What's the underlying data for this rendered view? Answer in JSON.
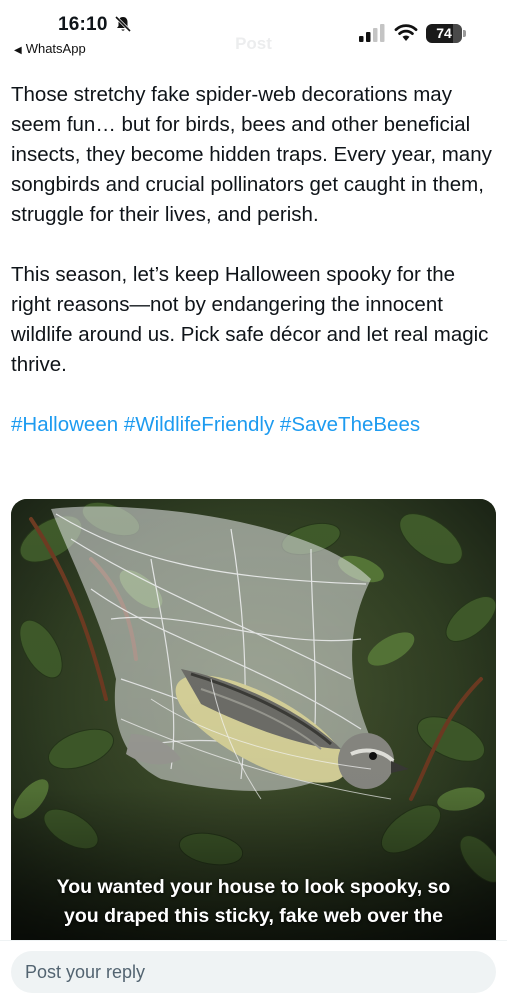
{
  "status_bar": {
    "time": "16:10",
    "back_app": "WhatsApp",
    "battery": "74",
    "header_title": "Post"
  },
  "post": {
    "paragraphs": [
      "Those stretchy fake spider-web decorations may seem fun… but for birds, bees and other beneficial insects, they become hidden traps. Every year, many songbirds and crucial pollinators get caught in them, struggle for their lives, and perish.",
      "This season, let’s keep Halloween spooky for the right reasons—not by endangering the innocent wildlife around us. Pick safe décor and let real magic thrive."
    ],
    "hashtags": [
      "#Halloween",
      "#WildlifeFriendly",
      "#SaveTheBees"
    ]
  },
  "media": {
    "caption_lines": [
      "You wanted your house to look spooky, so",
      "you draped this sticky, fake web over the"
    ]
  },
  "reply": {
    "placeholder": "Post your reply"
  },
  "colors": {
    "link": "#1d9bf0",
    "text": "#0f1419",
    "reply_bg": "#eff3f4"
  },
  "icons": [
    "bell-slash-icon",
    "chevron-left-icon",
    "cellular-signal-icon",
    "wifi-icon",
    "battery-icon"
  ]
}
